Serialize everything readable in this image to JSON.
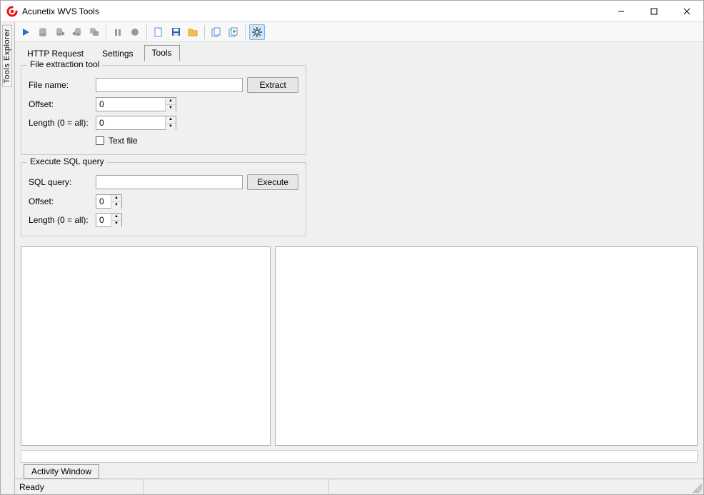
{
  "window": {
    "title": "Acunetix WVS Tools"
  },
  "sidebar": {
    "tools_explorer_label": "Tools Explorer"
  },
  "tabs": {
    "http_request": "HTTP Request",
    "settings": "Settings",
    "tools": "Tools"
  },
  "file_extraction": {
    "legend": "File extraction tool",
    "file_name_label": "File name:",
    "file_name_value": "",
    "extract_btn": "Extract",
    "offset_label": "Offset:",
    "offset_value": "0",
    "length_label": "Length (0 = all):",
    "length_value": "0",
    "text_file_label": "Text file"
  },
  "execute_sql": {
    "legend": "Execute SQL query",
    "query_label": "SQL query:",
    "query_value": "",
    "execute_btn": "Execute",
    "offset_label": "Offset:",
    "offset_value": "0",
    "length_label": "Length (0 = all):",
    "length_value": "0"
  },
  "activity": {
    "tab_label": "Activity Window"
  },
  "status": {
    "ready": "Ready"
  },
  "toolbar_icons": {
    "play": "play-icon",
    "db1": "database-icon",
    "db_import": "database-import-icon",
    "db_export": "database-export-icon",
    "db_copy": "database-copy-icon",
    "pause": "pause-icon",
    "stop": "record-icon",
    "new": "new-file-icon",
    "save": "save-icon",
    "open": "open-folder-icon",
    "copy1": "copy-icon",
    "copy2": "copy-plus-icon",
    "settings": "gear-icon"
  }
}
